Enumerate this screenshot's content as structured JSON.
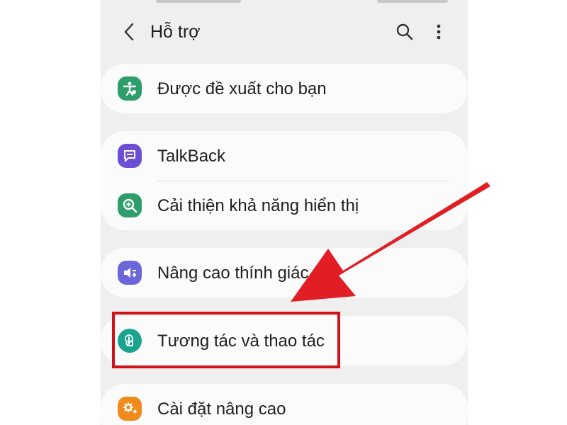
{
  "header": {
    "title": "Hỗ trợ",
    "back_icon": "chevron-left-icon",
    "search_icon": "search-icon",
    "more_icon": "more-vertical-icon"
  },
  "sections": [
    {
      "items": [
        {
          "label": "Được đề xuất cho bạn",
          "icon": "accessibility-recommended-icon",
          "icon_color": "#2e9e6a"
        }
      ]
    },
    {
      "items": [
        {
          "label": "TalkBack",
          "icon": "talkback-icon",
          "icon_color": "#6d4fd6"
        },
        {
          "label": "Cải thiện khả năng hiển thị",
          "icon": "visibility-enhance-icon",
          "icon_color": "#2e9e6a"
        }
      ]
    },
    {
      "items": [
        {
          "label": "Nâng cao thính giác",
          "icon": "hearing-enhance-icon",
          "icon_color": "#6b67d8"
        }
      ]
    },
    {
      "items": [
        {
          "label": "Tương tác và thao tác",
          "icon": "interaction-dexterity-icon",
          "icon_color": "#1aa38f"
        }
      ]
    },
    {
      "items": [
        {
          "label": "Cài đặt nâng cao",
          "icon": "advanced-settings-icon",
          "icon_color": "#f08a1c"
        }
      ]
    }
  ],
  "annotation": {
    "highlight_color": "#d0111b",
    "arrow_color": "#e01e24",
    "target": "Tương tác và thao tác"
  }
}
